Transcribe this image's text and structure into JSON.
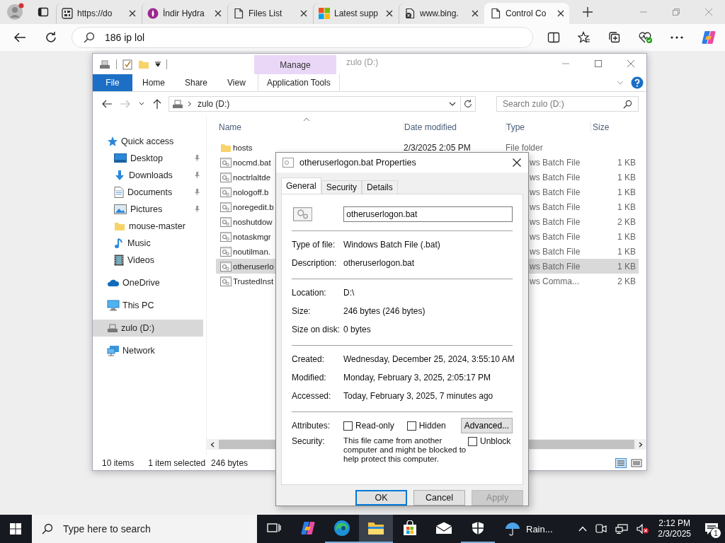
{
  "browser": {
    "tabs": [
      {
        "kind": "code",
        "title": "https://do",
        "selected": false
      },
      {
        "kind": "hydra",
        "title": "İndir Hydra",
        "selected": false
      },
      {
        "kind": "page",
        "title": "Files List",
        "selected": false
      },
      {
        "kind": "windows",
        "title": "Latest supp",
        "selected": false
      },
      {
        "kind": "bing",
        "title": "www.bing.",
        "selected": false
      },
      {
        "kind": "page",
        "title": "Control Co",
        "selected": true
      }
    ],
    "address": "186 ip lol"
  },
  "explorer": {
    "title": "zulo (D:)",
    "contextual_tab": "Manage",
    "file_button": "File",
    "ribbon_tabs": [
      {
        "label": "Home",
        "kind": "normal"
      },
      {
        "label": "Share",
        "kind": "normal"
      },
      {
        "label": "View",
        "kind": "normal"
      },
      {
        "label": "Application Tools",
        "kind": "contextual"
      }
    ],
    "path": "zulo (D:)",
    "search_placeholder": "Search zulo (D:)",
    "sidebar": [
      {
        "kind": "star",
        "label": "Quick access",
        "selected": false,
        "children": [
          {
            "kind": "desktop",
            "label": "Desktop",
            "pinned": true,
            "selected": false
          },
          {
            "kind": "download",
            "label": "Downloads",
            "pinned": true,
            "selected": false
          },
          {
            "kind": "document",
            "label": "Documents",
            "pinned": true,
            "selected": false
          },
          {
            "kind": "pictures",
            "label": "Pictures",
            "pinned": true,
            "selected": false
          },
          {
            "kind": "folder",
            "label": "mouse-master",
            "pinned": false,
            "selected": false
          },
          {
            "kind": "music",
            "label": "Music",
            "pinned": false,
            "selected": false
          },
          {
            "kind": "videos",
            "label": "Videos",
            "pinned": false,
            "selected": false
          }
        ]
      },
      {
        "kind": "cloud",
        "label": "OneDrive",
        "selected": false
      },
      {
        "kind": "pc",
        "label": "This PC",
        "selected": false
      },
      {
        "kind": "drive",
        "label": "zulo (D:)",
        "selected": true
      },
      {
        "kind": "network",
        "label": "Network",
        "selected": false
      }
    ],
    "columns": [
      "Name",
      "Date modified",
      "Type",
      "Size"
    ],
    "files": [
      {
        "kind": "folder",
        "name": "hosts",
        "date": "2/3/2025 2:05 PM",
        "type": "File folder",
        "selected": false
      },
      {
        "kind": "batch",
        "name": "nocmd.bat",
        "type": "ws Batch File",
        "size": "1 KB",
        "selected": false
      },
      {
        "kind": "batch",
        "name": "noctrlaltde",
        "type": "ws Batch File",
        "size": "1 KB",
        "selected": false
      },
      {
        "kind": "batch",
        "name": "nologoff.b",
        "type": "ws Batch File",
        "size": "1 KB",
        "selected": false
      },
      {
        "kind": "batch",
        "name": "noregedit.b",
        "type": "ws Batch File",
        "size": "1 KB",
        "selected": false
      },
      {
        "kind": "batch",
        "name": "noshutdow",
        "type": "ws Batch File",
        "size": "2 KB",
        "selected": false
      },
      {
        "kind": "batch",
        "name": "notaskmgr",
        "type": "ws Batch File",
        "size": "1 KB",
        "selected": false
      },
      {
        "kind": "batch",
        "name": "noutilman.",
        "type": "ws Batch File",
        "size": "1 KB",
        "selected": false
      },
      {
        "kind": "batch",
        "name": "otheruserlo",
        "type": "ws Batch File",
        "size": "1 KB",
        "selected": true
      },
      {
        "kind": "batch",
        "name": "TrustedInst",
        "type": "ws Comma...",
        "size": "2 KB",
        "selected": false
      }
    ],
    "status": [
      "10 items",
      "1 item selected",
      "246 bytes"
    ]
  },
  "dialog": {
    "title": "otheruserlogon.bat Properties",
    "tabs": [
      {
        "label": "General",
        "selected": true
      },
      {
        "label": "Security",
        "selected": false
      },
      {
        "label": "Details",
        "selected": false
      }
    ],
    "file_name": "otheruserlogon.bat",
    "groups": [
      [
        {
          "label": "Type of file:",
          "value": "Windows Batch File (.bat)"
        },
        {
          "label": "Description:",
          "value": "otheruserlogon.bat"
        }
      ],
      [
        {
          "label": "Location:",
          "value": "D:\\"
        },
        {
          "label": "Size:",
          "value": "246 bytes (246 bytes)"
        },
        {
          "label": "Size on disk:",
          "value": "0 bytes"
        }
      ],
      [
        {
          "label": "Created:",
          "value": "Wednesday, December 25, 2024, 3:55:10 AM"
        },
        {
          "label": "Modified:",
          "value": "Monday, February 3, 2025, 2:05:17 PM"
        },
        {
          "label": "Accessed:",
          "value": "Today, February 3, 2025, 7 minutes ago"
        }
      ]
    ],
    "attributes": {
      "label": "Attributes:",
      "options": [
        {
          "label": "Read-only",
          "checked": false
        },
        {
          "label": "Hidden",
          "checked": false
        }
      ],
      "advanced_button": "Advanced..."
    },
    "security": {
      "label": "Security:",
      "text": "This file came from another computer and might be blocked to help protect this computer.",
      "unblock": {
        "label": "Unblock",
        "checked": false
      }
    },
    "buttons": [
      {
        "label": "OK",
        "default": true,
        "disabled": false
      },
      {
        "label": "Cancel",
        "default": false,
        "disabled": false
      },
      {
        "label": "Apply",
        "default": false,
        "disabled": true
      }
    ]
  },
  "taskbar": {
    "search_placeholder": "Type here to search",
    "apps": [
      {
        "kind": "task-view",
        "running": false,
        "active": false
      },
      {
        "kind": "copilot",
        "running": false,
        "active": false
      },
      {
        "kind": "edge",
        "running": true,
        "active": false
      },
      {
        "kind": "explorer",
        "running": true,
        "active": true
      },
      {
        "kind": "store",
        "running": false,
        "active": false
      },
      {
        "kind": "mail",
        "running": false,
        "active": false
      },
      {
        "kind": "shield",
        "running": true,
        "active": false
      }
    ],
    "weather": "Rain...",
    "time": "2:12 PM",
    "date": "2/3/2025",
    "notifications": "1"
  }
}
